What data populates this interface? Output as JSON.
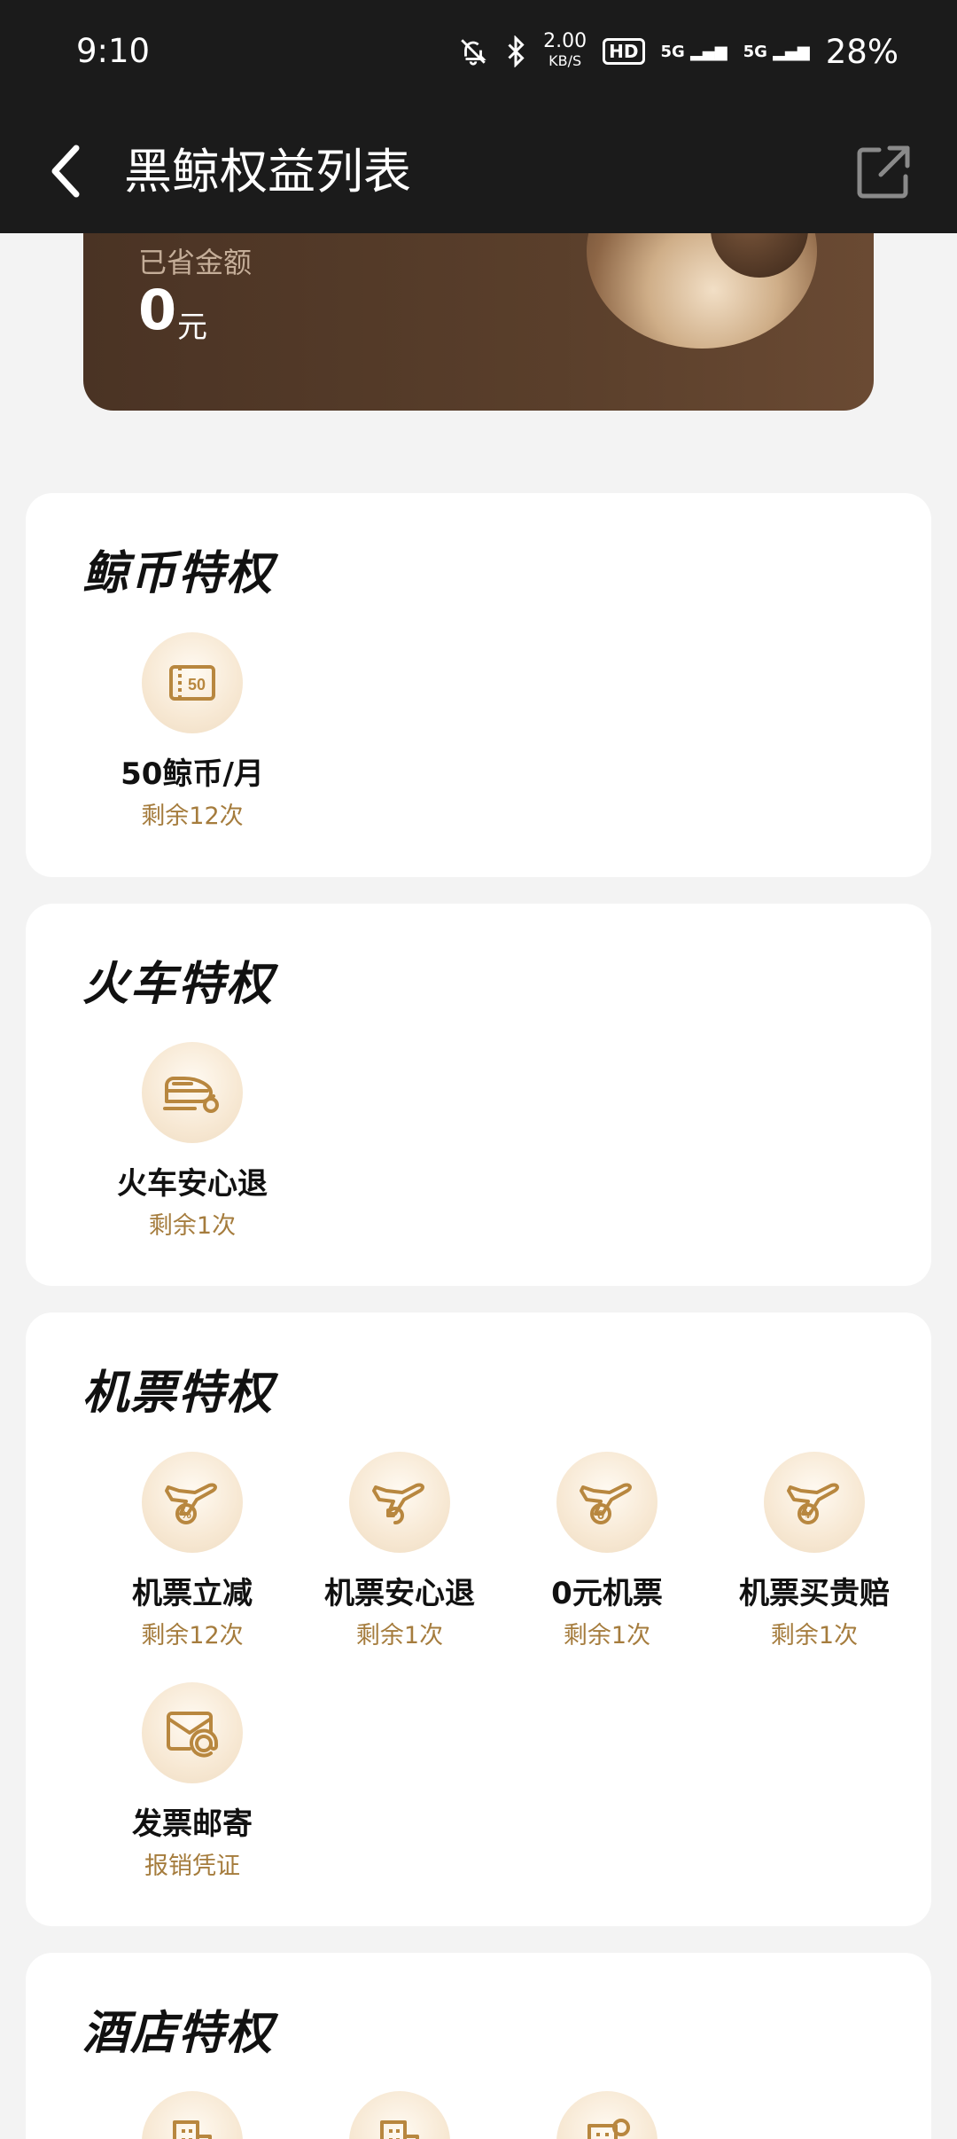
{
  "status": {
    "time": "9:10",
    "speed_value": "2.00",
    "speed_unit": "KB/S",
    "hd_badge": "HD",
    "net1": "5G",
    "net2": "5G",
    "battery": "28%"
  },
  "header": {
    "title": "黑鲸权益列表"
  },
  "hero": {
    "label": "已省金额",
    "amount": "0",
    "unit": "元"
  },
  "sections": [
    {
      "title": "鲸币特权",
      "items": [
        {
          "name": "50鲸币/月",
          "sub": "剩余12次",
          "icon": "coin-ticket-icon"
        }
      ]
    },
    {
      "title": "火车特权",
      "items": [
        {
          "name": "火车安心退",
          "sub": "剩余1次",
          "icon": "train-refund-icon"
        }
      ]
    },
    {
      "title": "机票特权",
      "items": [
        {
          "name": "机票立减",
          "sub": "剩余12次",
          "icon": "plane-discount-icon"
        },
        {
          "name": "机票安心退",
          "sub": "剩余1次",
          "icon": "plane-refund-icon"
        },
        {
          "name": "0元机票",
          "sub": "剩余1次",
          "icon": "plane-zero-icon"
        },
        {
          "name": "机票买贵赔",
          "sub": "剩余1次",
          "icon": "plane-price-icon"
        },
        {
          "name": "发票邮寄",
          "sub": "报销凭证",
          "icon": "invoice-mail-icon"
        }
      ]
    },
    {
      "title": "酒店特权",
      "items": []
    }
  ],
  "colors": {
    "accent_gold": "#a57c3d",
    "dark_header": "#1b1b1b",
    "hero_brown": "#4a3324",
    "icon_stroke": "#b8873f"
  }
}
